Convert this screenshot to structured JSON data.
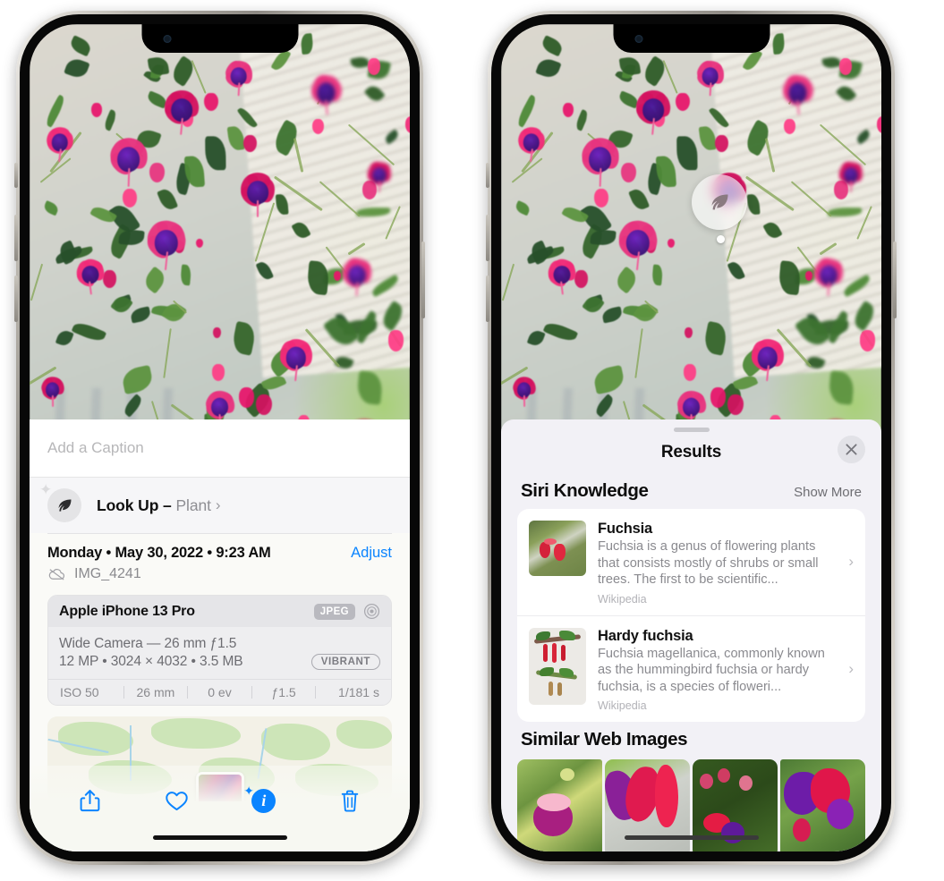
{
  "left_phone": {
    "caption": {
      "placeholder": "Add a Caption",
      "value": ""
    },
    "lookup": {
      "icon": "leaf-icon",
      "sparkle_icon": "sparkles-icon",
      "label": "Look Up –",
      "subject": "Plant",
      "chevron": "›"
    },
    "metadata": {
      "date": "Monday • May 30, 2022 • 9:23 AM",
      "adjust_label": "Adjust",
      "cloud_icon": "cloud-slash-icon",
      "filename": "IMG_4241"
    },
    "camera_card": {
      "device": "Apple iPhone 13 Pro",
      "format_badge": "JPEG",
      "aperture_icon": "aperture-icon",
      "lens_line": "Wide Camera — 26 mm ƒ1.5",
      "spec_line": "12 MP • 3024 × 4032 • 3.5 MB",
      "style_badge": "VIBRANT",
      "exif": [
        "ISO 50",
        "26 mm",
        "0 ev",
        "ƒ1.5",
        "1/181 s"
      ]
    },
    "map": {
      "pin_label": "photo-thumbnail-pin"
    },
    "toolbar": [
      {
        "name": "share-button",
        "icon": "share-icon"
      },
      {
        "name": "favorite-button",
        "icon": "heart-icon"
      },
      {
        "name": "info-button",
        "icon": "info-sparkle-icon",
        "glyph": "i"
      },
      {
        "name": "delete-button",
        "icon": "trash-icon"
      }
    ]
  },
  "right_phone": {
    "visual_lookup_badge": {
      "icon": "leaf-icon"
    },
    "sheet": {
      "grabber": "drag-handle",
      "title": "Results",
      "close_icon": "close-icon"
    },
    "siri_knowledge": {
      "heading": "Siri Knowledge",
      "action": "Show More",
      "items": [
        {
          "title": "Fuchsia",
          "description": "Fuchsia is a genus of flowering plants that consists mostly of shrubs or small trees. The first to be scientific...",
          "source": "Wikipedia",
          "chevron": "›"
        },
        {
          "title": "Hardy fuchsia",
          "description": "Fuchsia magellanica, commonly known as the hummingbird fuchsia or hardy fuchsia, is a species of floweri...",
          "source": "Wikipedia",
          "chevron": "›"
        }
      ]
    },
    "similar_web_images": {
      "heading": "Similar Web Images",
      "thumbnails": [
        "web-image-1",
        "web-image-2",
        "web-image-3",
        "web-image-4"
      ]
    }
  },
  "colors": {
    "accent_blue": "#0a84ff",
    "sheet_bg": "#f2f1f6",
    "card_white": "#ffffff",
    "secondary_text": "#8a8a8f"
  }
}
